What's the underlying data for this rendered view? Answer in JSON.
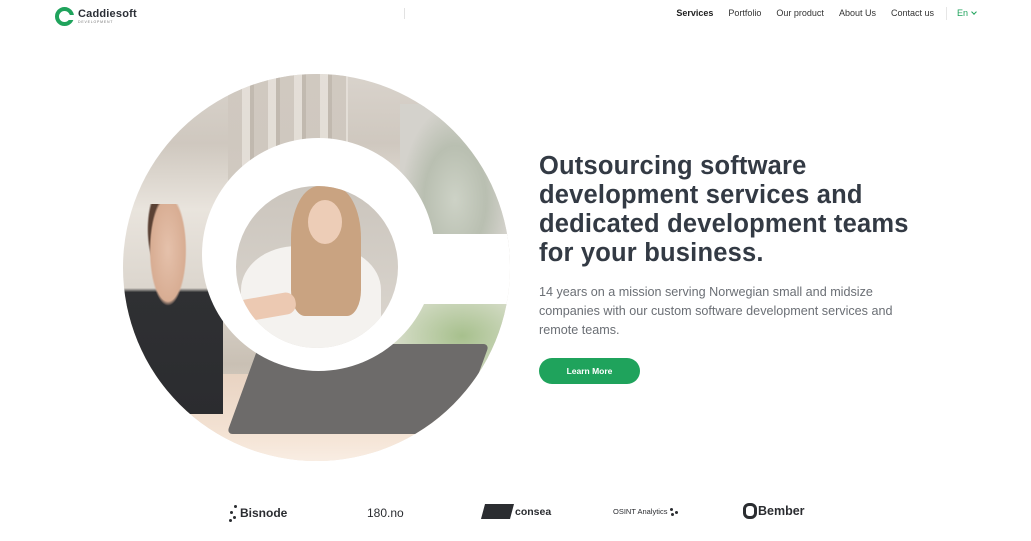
{
  "header": {
    "logo_name": "Caddiesoft",
    "logo_sub": "DEVELOPMENT",
    "nav": [
      {
        "label": "Services",
        "active": true
      },
      {
        "label": "Portfolio",
        "active": false
      },
      {
        "label": "Our product",
        "active": false
      },
      {
        "label": "About Us",
        "active": false
      },
      {
        "label": "Contact us",
        "active": false
      }
    ],
    "language": "En"
  },
  "hero": {
    "title": "Outsourcing software development services and dedicated development teams for your business.",
    "subtitle": "14 years on a mission serving Norwegian small and midsize companies with our custom software development services and remote teams.",
    "cta_label": "Learn More"
  },
  "clients": {
    "bisnode": "Bisnode",
    "n180_main": "180",
    "n180_suffix": ".no",
    "consea": "consea",
    "osint": "OSINT Analytics",
    "bember": "Bember"
  },
  "colors": {
    "accent": "#1fa35c",
    "heading": "#333a44",
    "body_text": "#6b6f75"
  }
}
